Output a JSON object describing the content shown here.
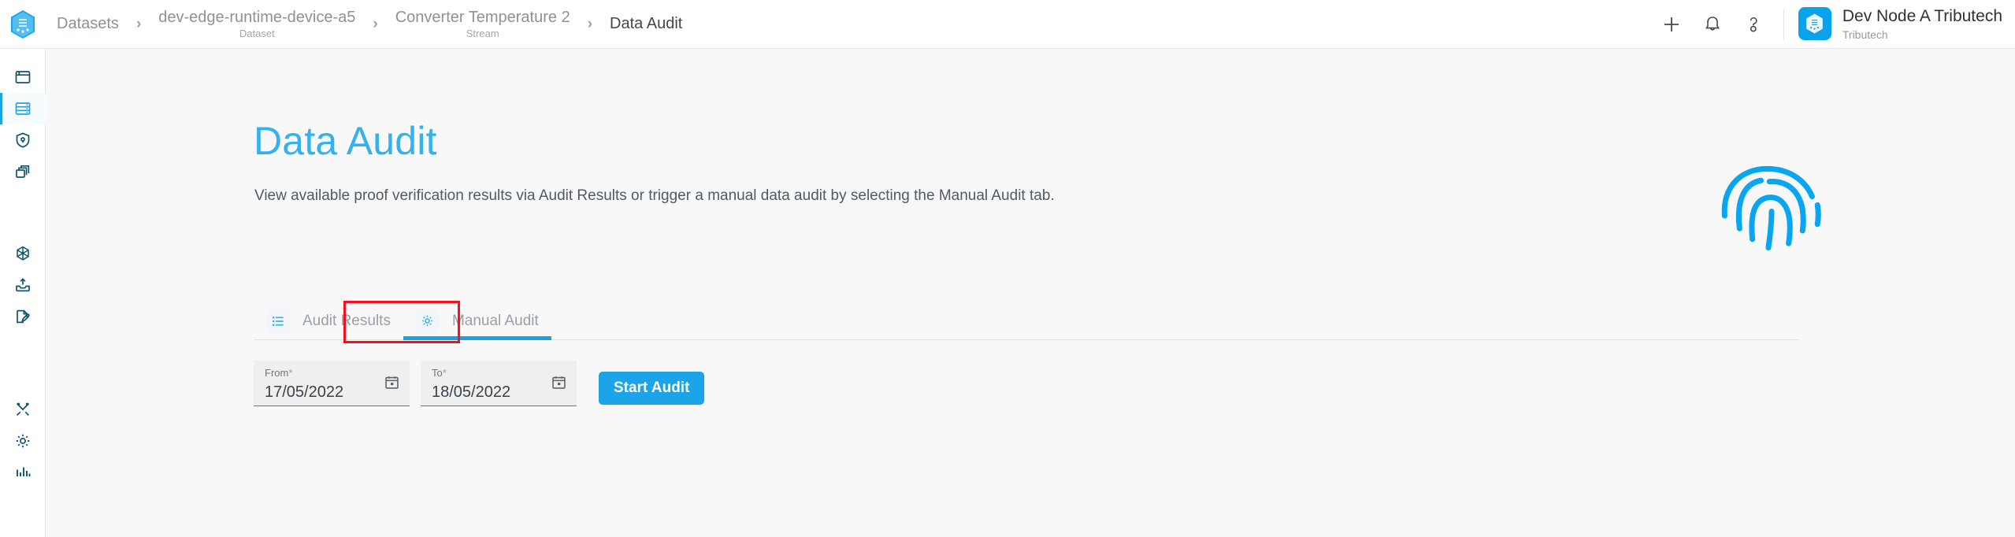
{
  "header": {
    "logo_icon": "tributech-hexagon-logo",
    "breadcrumb": [
      {
        "label": "Datasets",
        "sub": ""
      },
      {
        "label": "dev-edge-runtime-device-a5",
        "sub": "Dataset"
      },
      {
        "label": "Converter Temperature 2",
        "sub": "Stream"
      },
      {
        "label": "Data Audit",
        "sub": ""
      }
    ],
    "separator": "›",
    "actions": [
      {
        "name": "add-icon",
        "glyph": "plus"
      },
      {
        "name": "notifications-icon",
        "glyph": "bell"
      },
      {
        "name": "help-icon",
        "glyph": "question-mark"
      }
    ],
    "profile": {
      "name": "Dev Node A Tributech",
      "org": "Tributech",
      "avatar_icon": "tributech-hexagon-logo",
      "avatar_color": "#0aa2ec"
    }
  },
  "sidebar": {
    "items": [
      {
        "name": "sidebar-item-dashboard",
        "icon": "window-icon",
        "active": false
      },
      {
        "name": "sidebar-item-datasets",
        "icon": "database-icon",
        "active": true
      },
      {
        "name": "sidebar-item-security",
        "icon": "shield-lock-icon",
        "active": false
      },
      {
        "name": "sidebar-item-layers",
        "icon": "layers-icon",
        "active": false
      },
      {
        "name": "sidebar-item-nodes",
        "icon": "network-node-icon",
        "active": false
      },
      {
        "name": "sidebar-item-upload",
        "icon": "upload-inbox-icon",
        "active": false
      },
      {
        "name": "sidebar-item-contracts",
        "icon": "document-edit-icon",
        "active": false
      },
      {
        "name": "sidebar-item-tools",
        "icon": "tools-icon",
        "active": false
      },
      {
        "name": "sidebar-item-settings",
        "icon": "gear-icon",
        "active": false
      },
      {
        "name": "sidebar-item-analytics",
        "icon": "bar-chart-icon",
        "active": false
      }
    ]
  },
  "main": {
    "title": "Data Audit",
    "description": "View available proof verification results via Audit Results or trigger a manual data audit by selecting the Manual Audit tab.",
    "hero_icon": "fingerprint-icon",
    "accent_color": "#34b1ef",
    "tabs": [
      {
        "label": "Audit Results",
        "icon": "list-icon",
        "active": false
      },
      {
        "label": "Manual Audit",
        "icon": "gear-icon",
        "active": true
      }
    ],
    "highlight_color": "#fc0d1c",
    "form": {
      "from": {
        "label": "From",
        "required": "*",
        "value": "17/05/2022",
        "icon": "calendar-icon"
      },
      "to": {
        "label": "To",
        "required": "*",
        "value": "18/05/2022",
        "icon": "calendar-icon"
      },
      "submit_label": "Start Audit",
      "submit_color": "#1ba4e8"
    }
  }
}
